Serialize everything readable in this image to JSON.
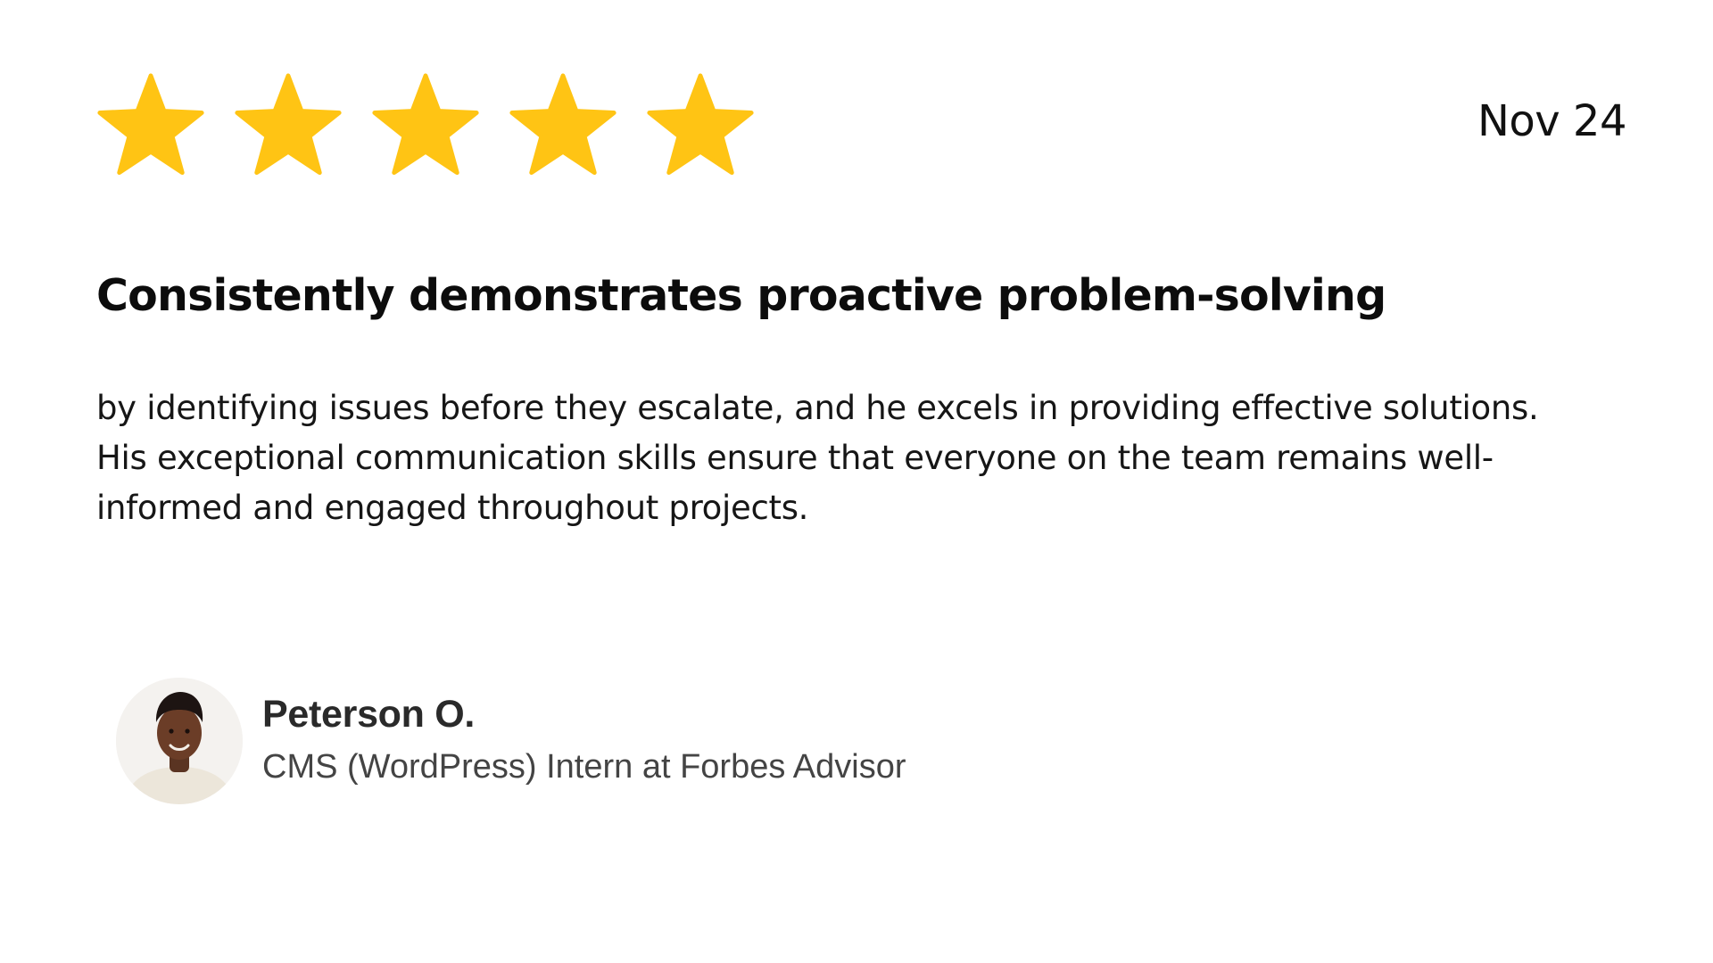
{
  "rating": {
    "value": 5,
    "max": 5,
    "star_color": "#FFC414",
    "icon": "star-icon"
  },
  "date": "Nov 24",
  "headline": "Consistently demonstrates proactive problem-solving",
  "body": {
    "lines": [
      "by identifying issues before they escalate, and he excels in providing effective solutions.",
      "His exceptional communication skills ensure that everyone on the team remains well-",
      "informed and engaged throughout projects."
    ]
  },
  "author": {
    "name": "Peterson O.",
    "role": "CMS (WordPress) Intern at Forbes Advisor",
    "avatar_icon": "avatar-photo"
  }
}
